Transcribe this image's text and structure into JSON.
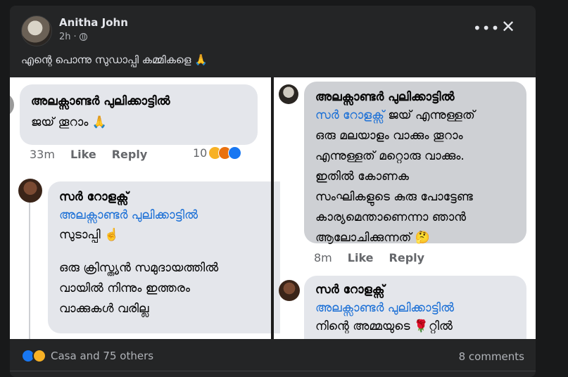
{
  "post": {
    "author": "Anitha John",
    "time": "2h",
    "caption": "എന്റെ പൊന്നു സുഡാപ്പി കമ്മികളെ 🙏"
  },
  "left": {
    "c1": {
      "name": "അലക്സാണ്ടർ പുലിക്കാട്ടിൽ",
      "text": "ജയ് തൂറാം 🙏",
      "time": "33m",
      "like": "Like",
      "reply": "Reply",
      "count": "10"
    },
    "c2": {
      "name": "സർ റോളക്സ്",
      "mention": "അലക്സാണ്ടർ പുലിക്കാട്ടിൽ",
      "line1": "സുടാപ്പി ☝️",
      "line2": "ഒരു ക്രിസ്ത്യൻ സമുദായത്തിൽ",
      "line3": "വായിൽ നിന്നും ഇത്തരം",
      "line4": "വാക്കുകൾ വരില്ല"
    }
  },
  "right": {
    "c1": {
      "name": "അലക്സാണ്ടർ പുലിക്കാട്ടിൽ",
      "mention": "സർ റോളക്സ്",
      "line1_rest": " ജയ് എന്നുള്ളത്",
      "line2": "ഒരു മലയാളം വാക്കും തൂറാം",
      "line3": "എന്നുള്ളത് മറ്റൊരു വാക്കും.",
      "line4": "ഇതിൽ കോണക",
      "line5": "സംഘികളുടെ കുരു പോട്ടേണ്ട",
      "line6": "കാര്യമെന്താണെന്നാ ഞാൻ",
      "line7": "ആലോചിക്കുന്നത് 🤔",
      "time": "8m",
      "like": "Like",
      "reply": "Reply"
    },
    "c2": {
      "name": "സർ റോളക്സ്",
      "mention": "അലക്സാണ്ടർ പുലിക്കാട്ടിൽ",
      "line1": "നിന്റെ അമ്മയുടെ 🌹റ്റിൽ"
    }
  },
  "footer": {
    "reactors": "Casa and 75 others",
    "comments": "8 comments"
  },
  "colors": {
    "card": "#242526",
    "text": "#e4e6eb",
    "muted": "#b0b3b8",
    "link": "#1a6fd6",
    "bubble": "#e4e6eb"
  }
}
